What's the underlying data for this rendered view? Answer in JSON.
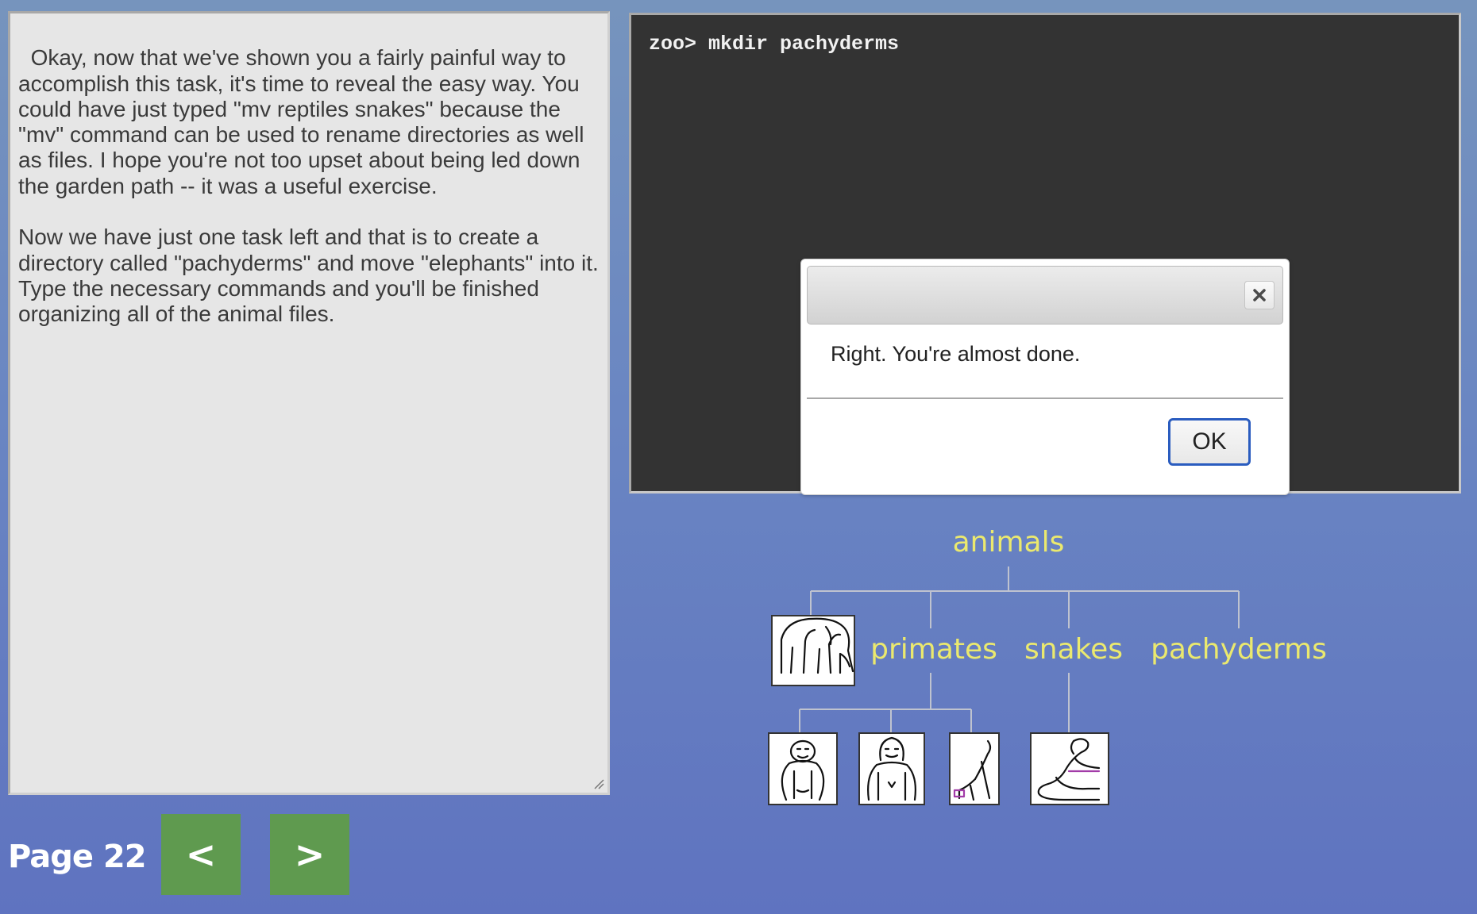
{
  "lesson": {
    "text": "Okay, now that we've shown you a fairly painful way to accomplish this task, it's time to reveal the easy way. You could have just typed \"mv reptiles snakes\" because the \"mv\" command can be used to rename directories as well as files. I hope you're not too upset about being led down the garden path -- it was a useful exercise.\n\nNow we have just one task left and that is to create a directory called \"pachyderms\" and move \"elephants\" into it. Type the necessary commands and you'll be finished organizing all of the animal files."
  },
  "navigation": {
    "page_label": "Page 22",
    "prev_label": "<",
    "next_label": ">"
  },
  "terminal": {
    "lines": [
      "zoo> mkdir pachyderms"
    ]
  },
  "dialog": {
    "message": "Right. You're almost done.",
    "ok_label": "OK",
    "close_icon": "close-icon"
  },
  "tree": {
    "root": "animals",
    "dirs": [
      "primates",
      "snakes",
      "pachyderms"
    ],
    "files": [
      {
        "icon": "elephants-icon",
        "location": "animals"
      },
      {
        "icon": "orangutan-icon",
        "location": "primates"
      },
      {
        "icon": "gorilla-icon",
        "location": "primates"
      },
      {
        "icon": "monkey-icon",
        "location": "primates"
      },
      {
        "icon": "snake-icon",
        "location": "snakes"
      }
    ]
  },
  "colors": {
    "background_top": "#7694bd",
    "background_bottom": "#5f73c0",
    "nav_button": "#5f9a4f",
    "terminal_bg": "#333333",
    "tree_label": "#ebe96e",
    "ok_border": "#2a5cbf"
  }
}
